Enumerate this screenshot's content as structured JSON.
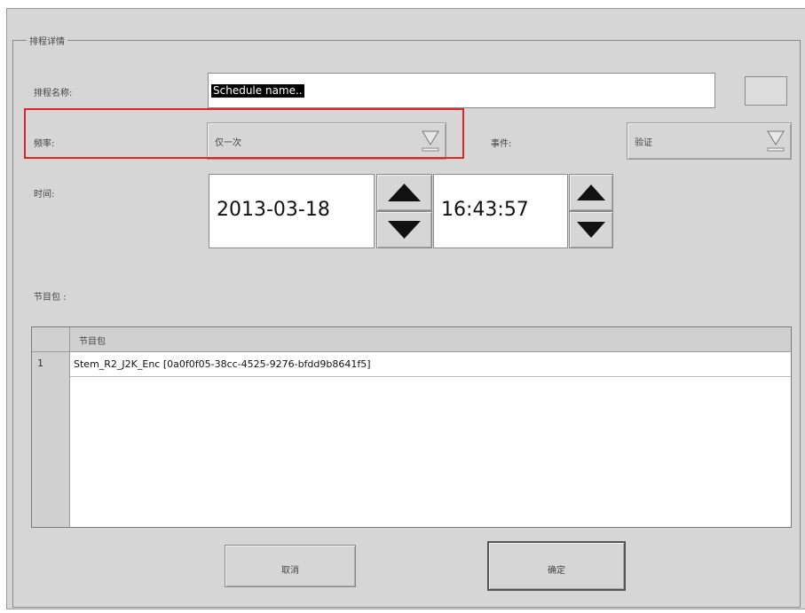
{
  "group": {
    "title": "排程详情"
  },
  "schedule_name": {
    "label": "排程名称:",
    "value": "Schedule name.."
  },
  "frequency": {
    "label": "频率:",
    "value": "仅一次"
  },
  "event": {
    "label": "事件:",
    "value": "验证"
  },
  "time": {
    "label": "时间:",
    "date": "2013-03-18",
    "clock": "16:43:57"
  },
  "packages": {
    "label": "节目包 :",
    "column": "节目包",
    "rows": [
      {
        "num": "1",
        "value": "Stem_R2_J2K_Enc [0a0f0f05-38cc-4525-9276-bfdd9b8641f5]"
      }
    ]
  },
  "buttons": {
    "cancel": "取消",
    "ok": "确定"
  },
  "icons": [
    "dropdown-triangle-icon",
    "spin-up-arrow-icon",
    "spin-down-arrow-icon"
  ],
  "colors": {
    "highlight": "#e0242b"
  }
}
